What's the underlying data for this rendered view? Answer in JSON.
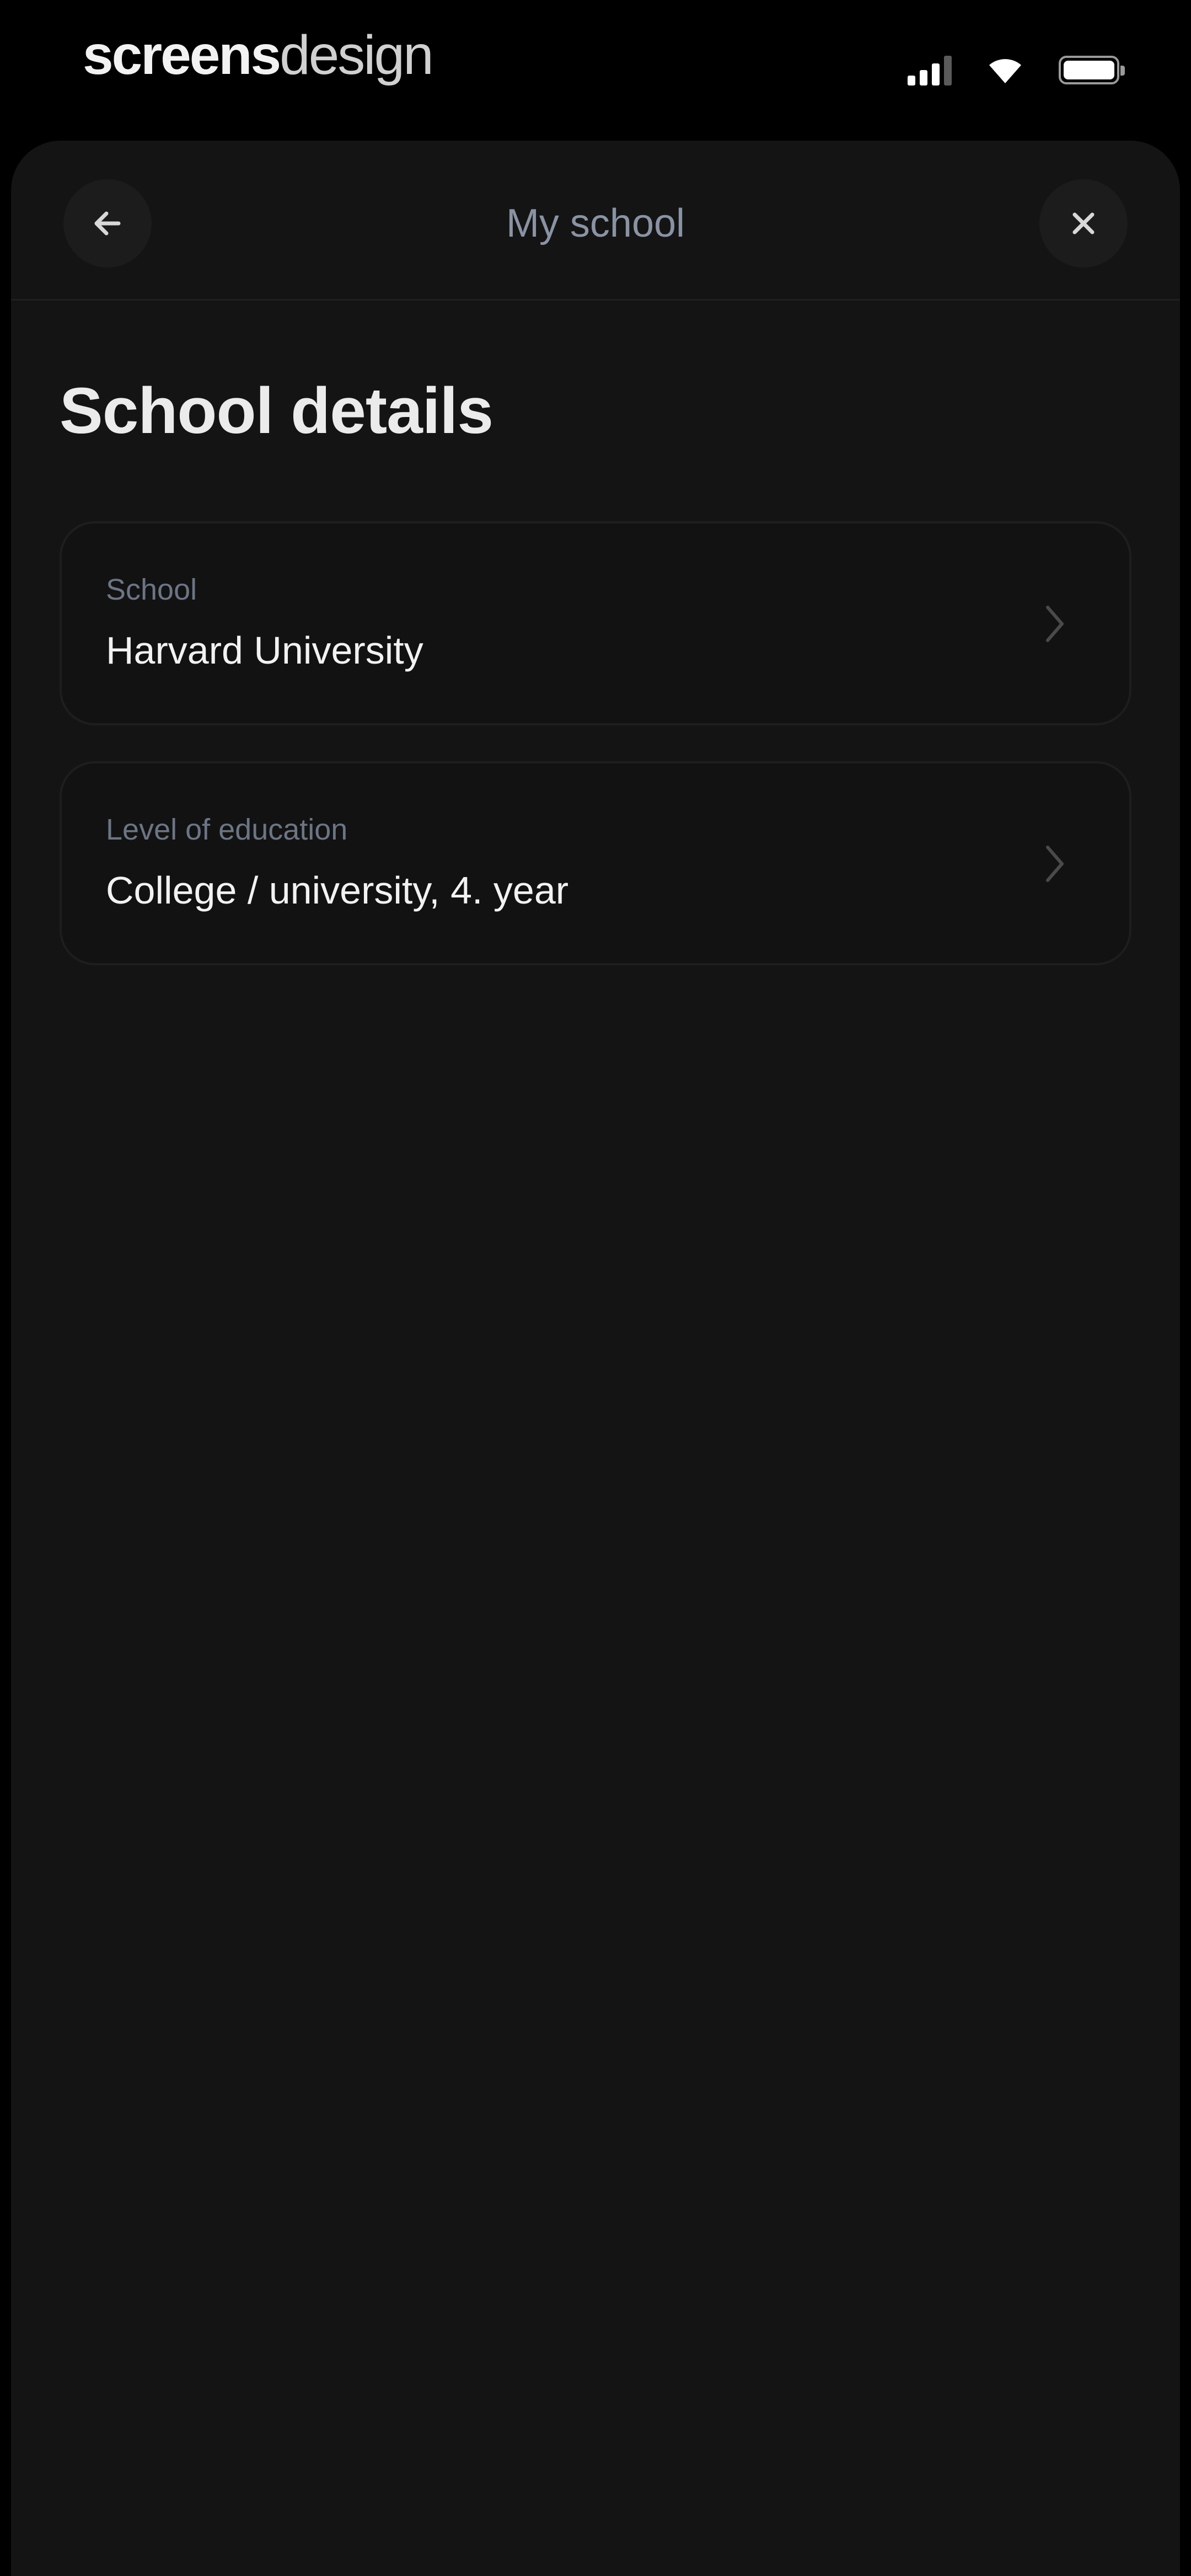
{
  "status_bar": {
    "watermark_bold": "screens",
    "watermark_light": "design",
    "icons": [
      "signal-icon",
      "wifi-icon",
      "battery-icon"
    ]
  },
  "header": {
    "title": "My school",
    "back_icon": "arrow-left-icon",
    "close_icon": "close-icon"
  },
  "main": {
    "title": "School details",
    "fields": [
      {
        "label": "School",
        "value": "Harvard University",
        "icon": "chevron-right-icon"
      },
      {
        "label": "Level of education",
        "value": "College / university, 4. year",
        "icon": "chevron-right-icon"
      }
    ]
  },
  "colors": {
    "background": "#000000",
    "sheet": "#141414",
    "card_border": "#1e1e1e",
    "label": "#6c7585",
    "header_title": "#8a93a3",
    "text": "#f2f2f2"
  }
}
